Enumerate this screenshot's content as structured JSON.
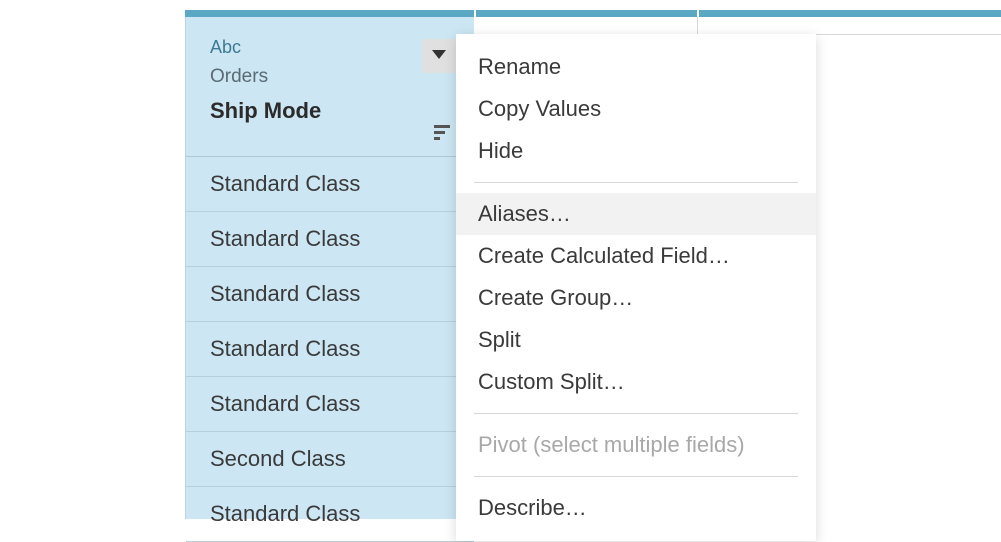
{
  "column": {
    "type_label": "Abc",
    "source_label": "Orders",
    "field_name": "Ship Mode",
    "cells": [
      "Standard Class",
      "Standard Class",
      "Standard Class",
      "Standard Class",
      "Standard Class",
      "Second Class",
      "Standard Class"
    ]
  },
  "menu": {
    "items": [
      {
        "label": "Rename",
        "type": "item"
      },
      {
        "label": "Copy Values",
        "type": "item"
      },
      {
        "label": "Hide",
        "type": "item"
      },
      {
        "type": "sep"
      },
      {
        "label": "Aliases…",
        "type": "item",
        "highlighted": true
      },
      {
        "label": "Create Calculated Field…",
        "type": "item"
      },
      {
        "label": "Create Group…",
        "type": "item"
      },
      {
        "label": "Split",
        "type": "item"
      },
      {
        "label": "Custom Split…",
        "type": "item"
      },
      {
        "type": "sep"
      },
      {
        "label": "Pivot (select multiple fields)",
        "type": "item",
        "disabled": true
      },
      {
        "type": "sep"
      },
      {
        "label": "Describe…",
        "type": "item"
      }
    ]
  }
}
